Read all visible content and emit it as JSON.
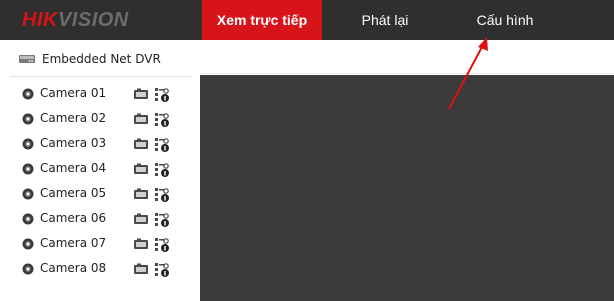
{
  "brand": {
    "logo_red": "HIK",
    "logo_gray": "VISION"
  },
  "nav": {
    "live_label": "Xem trực tiếp",
    "playback_label": "Phát lại",
    "config_label": "Cấu hình"
  },
  "device": {
    "name": "Embedded Net DVR",
    "icon": "dvr-icon"
  },
  "cameras": [
    {
      "label": "Camera 01"
    },
    {
      "label": "Camera 02"
    },
    {
      "label": "Camera 03"
    },
    {
      "label": "Camera 04"
    },
    {
      "label": "Camera 05"
    },
    {
      "label": "Camera 06"
    },
    {
      "label": "Camera 07"
    },
    {
      "label": "Camera 08"
    }
  ],
  "icons": {
    "camera": "camera-icon",
    "record": "record-icon",
    "ptz": "ptz-icon"
  },
  "colors": {
    "accent": "#d7141a",
    "topbar": "#2f2f2f",
    "video_bg": "#3b3b3b",
    "annotation_arrow": "#e01010"
  }
}
